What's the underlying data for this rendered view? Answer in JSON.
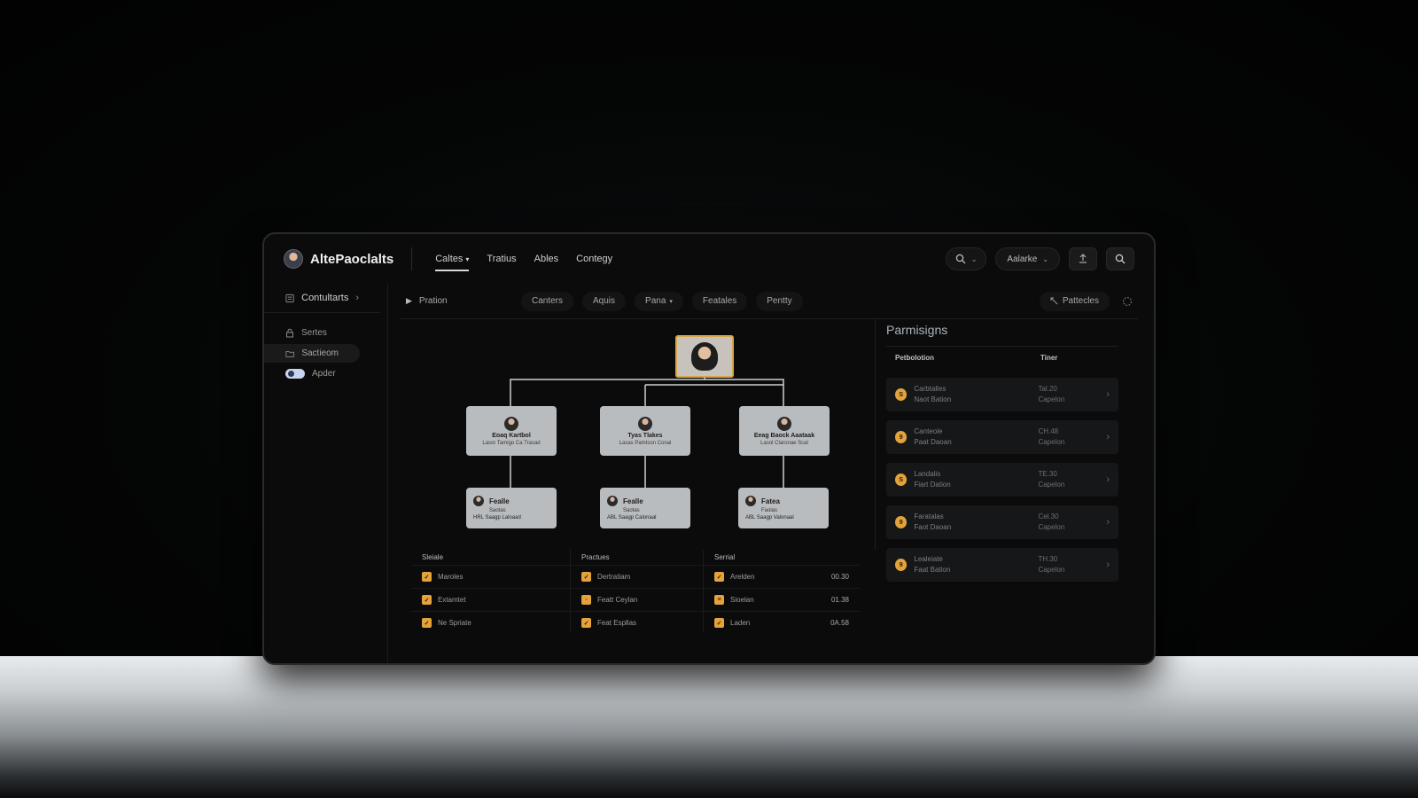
{
  "app": {
    "name": "AltePaoclalts"
  },
  "nav": [
    {
      "label": "Caltes",
      "dropdown": true,
      "active": true
    },
    {
      "label": "Tratius",
      "dropdown": false,
      "active": false
    },
    {
      "label": "Ables",
      "dropdown": false,
      "active": false
    },
    {
      "label": "Contegy",
      "dropdown": false,
      "active": false
    }
  ],
  "topbar": {
    "search_icon": "search-icon",
    "account_label": "Aalarke",
    "upload_icon": "upload-icon",
    "search2_icon": "search-icon"
  },
  "sidebar": {
    "header": "Contultarts",
    "items": [
      {
        "label": "Sertes",
        "icon": "lock-icon"
      },
      {
        "label": "Sactieom",
        "icon": "folder-icon",
        "active": true
      },
      {
        "label": "Apder",
        "icon": "toggle-icon"
      }
    ]
  },
  "filterbar": {
    "left_label": "Pration",
    "chips": [
      "Canters",
      "Aquis",
      "Pana",
      "Featales",
      "Pentty"
    ],
    "chip_dropdown_index": 2,
    "right_label": "Pattecles"
  },
  "org": {
    "root": {
      "face": "avatar"
    },
    "level1": [
      {
        "name": "Eoaq Kartbol",
        "sub": "Lasor Tamigo Ca Trasad"
      },
      {
        "name": "Tyas Tlakes",
        "sub": "Lasas Pamtson Conal"
      },
      {
        "name": "Eeag Baock Aaataak",
        "sub": "Lasol Claronae Scal"
      }
    ],
    "level2": [
      {
        "name": "Fealle",
        "line2": "Saotas",
        "line3": "HRL Saagp Laloaad"
      },
      {
        "name": "Fealle",
        "line2": "Saotas",
        "line3": "ABL Saagp Calonaal"
      },
      {
        "name": "Fatea",
        "line2": "Faolas",
        "line3": "ABL Saagp Valonaal"
      }
    ]
  },
  "table": {
    "columns": [
      {
        "header": "Sleiale",
        "rows": [
          {
            "badge": "✓",
            "label": "Maroles",
            "value": ""
          },
          {
            "badge": "✓",
            "label": "Extamtet",
            "value": ""
          },
          {
            "badge": "✓",
            "label": "Ne Spriate",
            "value": ""
          }
        ]
      },
      {
        "header": "Practues",
        "rows": [
          {
            "badge": "✓",
            "label": "Dertratiam",
            "value": ""
          },
          {
            "badge": "◦",
            "label": "Featt Ceylan",
            "value": ""
          },
          {
            "badge": "✓",
            "label": "Feat Espllas",
            "value": ""
          }
        ]
      },
      {
        "header": "Serrial",
        "rows": [
          {
            "badge": "✓",
            "label": "Arelden",
            "value": "00.30"
          },
          {
            "badge": "≡",
            "label": "Sioelan",
            "value": "01.38"
          },
          {
            "badge": "✓",
            "label": "Laden",
            "value": "0A.58"
          }
        ]
      }
    ]
  },
  "permissions": {
    "title": "Parmisigns",
    "col1": "Petbolotion",
    "col2": "Tiner",
    "rows": [
      {
        "badge": "S",
        "line1": "Carbtalles",
        "line2": "Naot Bation",
        "t1": "Tal.20",
        "t2": "Capelon"
      },
      {
        "badge": "9",
        "line1": "Canteole",
        "line2": "Paat Daoan",
        "t1": "CH.48",
        "t2": "Capelon"
      },
      {
        "badge": "S",
        "line1": "Landalis",
        "line2": "Fiart Dation",
        "t1": "TE.30",
        "t2": "Capelon"
      },
      {
        "badge": "9",
        "line1": "Faratalas",
        "line2": "Faot Daoan",
        "t1": "Cel.30",
        "t2": "Capelon"
      },
      {
        "badge": "9",
        "line1": "Lealeiate",
        "line2": "Faat Bation",
        "t1": "TH.30",
        "t2": "Capelon"
      }
    ]
  }
}
